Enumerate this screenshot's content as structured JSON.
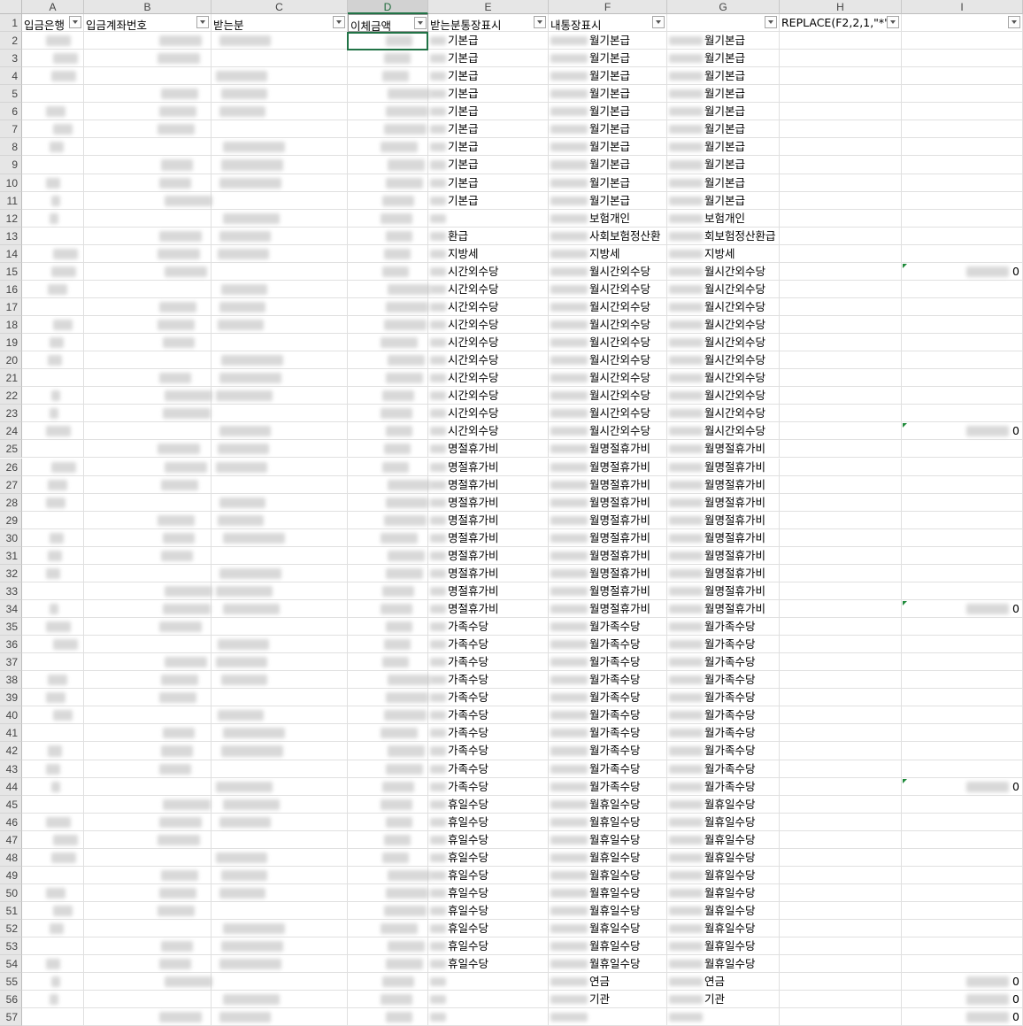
{
  "columns": [
    {
      "letter": "A",
      "header": "입금은행",
      "filter": true
    },
    {
      "letter": "B",
      "header": "입금계좌번호",
      "filter": true
    },
    {
      "letter": "C",
      "header": "받는분",
      "filter": true
    },
    {
      "letter": "D",
      "header": "이체금액",
      "filter": true
    },
    {
      "letter": "E",
      "header": "받는분통장표시",
      "filter": true
    },
    {
      "letter": "F",
      "header": "내통장표시",
      "filter": true
    },
    {
      "letter": "G",
      "header": "",
      "filter": true
    },
    {
      "letter": "H",
      "header": "REPLACE(F2,2,1,\"*\")",
      "filter": true
    },
    {
      "letter": "I",
      "header": "",
      "filter": true
    }
  ],
  "selected_column": "D",
  "active_cell": "D2",
  "rows": [
    {
      "n": "2",
      "e": "기본급",
      "f": "월기본급",
      "g": "월기본급",
      "i": ""
    },
    {
      "n": "3",
      "e": "기본급",
      "f": "월기본급",
      "g": "월기본급",
      "i": ""
    },
    {
      "n": "4",
      "e": "기본급",
      "f": "월기본급",
      "g": "월기본급",
      "i": ""
    },
    {
      "n": "5",
      "e": "기본급",
      "f": "월기본급",
      "g": "월기본급",
      "i": ""
    },
    {
      "n": "6",
      "e": "기본급",
      "f": "월기본급",
      "g": "월기본급",
      "i": ""
    },
    {
      "n": "7",
      "e": "기본급",
      "f": "월기본급",
      "g": "월기본급",
      "i": ""
    },
    {
      "n": "8",
      "e": "기본급",
      "f": "월기본급",
      "g": "월기본급",
      "i": ""
    },
    {
      "n": "9",
      "e": "기본급",
      "f": "월기본급",
      "g": "월기본급",
      "i": ""
    },
    {
      "n": "10",
      "e": "기본급",
      "f": "월기본급",
      "g": "월기본급",
      "i": ""
    },
    {
      "n": "11",
      "e": "기본급",
      "f": "월기본급",
      "g": "월기본급",
      "i": ""
    },
    {
      "n": "12",
      "e": "",
      "f": "보험개인",
      "g": "보험개인",
      "i": ""
    },
    {
      "n": "13",
      "e": "환급",
      "f": "사회보험정산환",
      "g": "회보험정산환급",
      "i": ""
    },
    {
      "n": "14",
      "e": "지방세",
      "f": "지방세",
      "g": "지방세",
      "i": ""
    },
    {
      "n": "15",
      "e": "시간외수당",
      "f": "월시간외수당",
      "g": "월시간외수당",
      "i": "0"
    },
    {
      "n": "16",
      "e": "시간외수당",
      "f": "월시간외수당",
      "g": "월시간외수당",
      "i": ""
    },
    {
      "n": "17",
      "e": "시간외수당",
      "f": "월시간외수당",
      "g": "월시간외수당",
      "i": ""
    },
    {
      "n": "18",
      "e": "시간외수당",
      "f": "월시간외수당",
      "g": "월시간외수당",
      "i": ""
    },
    {
      "n": "19",
      "e": "시간외수당",
      "f": "월시간외수당",
      "g": "월시간외수당",
      "i": ""
    },
    {
      "n": "20",
      "e": "시간외수당",
      "f": "월시간외수당",
      "g": "월시간외수당",
      "i": ""
    },
    {
      "n": "21",
      "e": "시간외수당",
      "f": "월시간외수당",
      "g": "월시간외수당",
      "i": ""
    },
    {
      "n": "22",
      "e": "시간외수당",
      "f": "월시간외수당",
      "g": "월시간외수당",
      "i": ""
    },
    {
      "n": "23",
      "e": "시간외수당",
      "f": "월시간외수당",
      "g": "월시간외수당",
      "i": ""
    },
    {
      "n": "24",
      "e": "시간외수당",
      "f": "월시간외수당",
      "g": "월시간외수당",
      "i": "0"
    },
    {
      "n": "25",
      "e": "명절휴가비",
      "f": "월명절휴가비",
      "g": "월명절휴가비",
      "i": ""
    },
    {
      "n": "26",
      "e": "명절휴가비",
      "f": "월명절휴가비",
      "g": "월명절휴가비",
      "i": ""
    },
    {
      "n": "27",
      "e": "명절휴가비",
      "f": "월명절휴가비",
      "g": "월명절휴가비",
      "i": ""
    },
    {
      "n": "28",
      "e": "명절휴가비",
      "f": "월명절휴가비",
      "g": "월명절휴가비",
      "i": ""
    },
    {
      "n": "29",
      "e": "명절휴가비",
      "f": "월명절휴가비",
      "g": "월명절휴가비",
      "i": ""
    },
    {
      "n": "30",
      "e": "명절휴가비",
      "f": "월명절휴가비",
      "g": "월명절휴가비",
      "i": ""
    },
    {
      "n": "31",
      "e": "명절휴가비",
      "f": "월명절휴가비",
      "g": "월명절휴가비",
      "i": ""
    },
    {
      "n": "32",
      "e": "명절휴가비",
      "f": "월명절휴가비",
      "g": "월명절휴가비",
      "i": ""
    },
    {
      "n": "33",
      "e": "명절휴가비",
      "f": "월명절휴가비",
      "g": "월명절휴가비",
      "i": ""
    },
    {
      "n": "34",
      "e": "명절휴가비",
      "f": "월명절휴가비",
      "g": "월명절휴가비",
      "i": "0"
    },
    {
      "n": "35",
      "e": "가족수당",
      "f": "월가족수당",
      "g": "월가족수당",
      "i": ""
    },
    {
      "n": "36",
      "e": "가족수당",
      "f": "월가족수당",
      "g": "월가족수당",
      "i": ""
    },
    {
      "n": "37",
      "e": "가족수당",
      "f": "월가족수당",
      "g": "월가족수당",
      "i": ""
    },
    {
      "n": "38",
      "e": "가족수당",
      "f": "월가족수당",
      "g": "월가족수당",
      "i": ""
    },
    {
      "n": "39",
      "e": "가족수당",
      "f": "월가족수당",
      "g": "월가족수당",
      "i": ""
    },
    {
      "n": "40",
      "e": "가족수당",
      "f": "월가족수당",
      "g": "월가족수당",
      "i": ""
    },
    {
      "n": "41",
      "e": "가족수당",
      "f": "월가족수당",
      "g": "월가족수당",
      "i": ""
    },
    {
      "n": "42",
      "e": "가족수당",
      "f": "월가족수당",
      "g": "월가족수당",
      "i": ""
    },
    {
      "n": "43",
      "e": "가족수당",
      "f": "월가족수당",
      "g": "월가족수당",
      "i": ""
    },
    {
      "n": "44",
      "e": "가족수당",
      "f": "월가족수당",
      "g": "월가족수당",
      "i": "0"
    },
    {
      "n": "45",
      "e": "휴일수당",
      "f": "월휴일수당",
      "g": "월휴일수당",
      "i": ""
    },
    {
      "n": "46",
      "e": "휴일수당",
      "f": "월휴일수당",
      "g": "월휴일수당",
      "i": ""
    },
    {
      "n": "47",
      "e": "휴일수당",
      "f": "월휴일수당",
      "g": "월휴일수당",
      "i": ""
    },
    {
      "n": "48",
      "e": "휴일수당",
      "f": "월휴일수당",
      "g": "월휴일수당",
      "i": ""
    },
    {
      "n": "49",
      "e": "휴일수당",
      "f": "월휴일수당",
      "g": "월휴일수당",
      "i": ""
    },
    {
      "n": "50",
      "e": "휴일수당",
      "f": "월휴일수당",
      "g": "월휴일수당",
      "i": ""
    },
    {
      "n": "51",
      "e": "휴일수당",
      "f": "월휴일수당",
      "g": "월휴일수당",
      "i": ""
    },
    {
      "n": "52",
      "e": "휴일수당",
      "f": "월휴일수당",
      "g": "월휴일수당",
      "i": ""
    },
    {
      "n": "53",
      "e": "휴일수당",
      "f": "월휴일수당",
      "g": "월휴일수당",
      "i": ""
    },
    {
      "n": "54",
      "e": "휴일수당",
      "f": "월휴일수당",
      "g": "월휴일수당",
      "i": ""
    },
    {
      "n": "55",
      "e": "",
      "f": "연금",
      "g": "연금",
      "i": "0"
    },
    {
      "n": "56",
      "e": "",
      "f": "기관",
      "g": "기관",
      "i": "0"
    },
    {
      "n": "57",
      "e": "",
      "f": "",
      "g": "",
      "i": "0"
    }
  ],
  "colors": {
    "header_bg": "#e6e6e6",
    "selected_accent": "#217346",
    "grid": "#e0e0e0",
    "comment_marker": "#1e8a3a"
  },
  "comment_rows": [
    "15",
    "24",
    "34",
    "44"
  ]
}
